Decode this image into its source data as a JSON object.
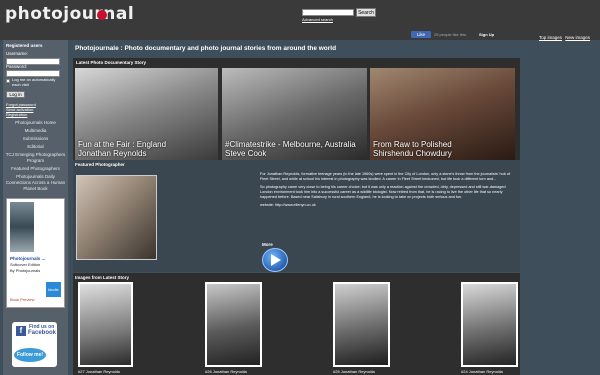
{
  "header": {
    "logo_text": "photojournal",
    "search_button": "Search",
    "advanced_search": "Advanced search"
  },
  "sidebar": {
    "title": "Registered users",
    "username_label": "Username:",
    "password_label": "Password:",
    "remember_label": "Log me on automatically each visit",
    "login_button": "Log in",
    "links": [
      "Forgot password",
      "Send activation",
      "Registration"
    ],
    "nav": [
      "Photojournals Home",
      "Multimedia",
      "Submissions",
      "Editorial",
      "TCJ Emerging Photographers Program",
      "Featured Photographers",
      "Photojournals Daily Connections Across a Human Planet Book"
    ]
  },
  "book": {
    "title": "Photojournals ...",
    "edition": "Softcover Edition",
    "author": "By Photojournals",
    "kindle": "kindle",
    "preview": "Book Preview"
  },
  "facebook": {
    "find_us": "Find us on",
    "name": "Facebook",
    "follow": "Follow me!",
    "like": "Like",
    "like_text": "25 people like this.",
    "signup": "Sign Up"
  },
  "toplinks": [
    "Top images",
    "New images"
  ],
  "page_title": "Photojournale : Photo documentary and photo journal stories from around the world",
  "latest_story": {
    "label": "Latest Photo Documentary Story",
    "items": [
      {
        "caption": "Fun at the Fair : England\nJonathan Reynolds"
      },
      {
        "caption": "#Climatestrike - Melbourne, Australia\nSteve Cook"
      },
      {
        "caption": "From Raw to Polished\nShirshendu Chowdury"
      }
    ]
  },
  "featured": {
    "label": "Featured Photographer",
    "bio": [
      "For Jonathan Reynolds, formative teenage years (in the late 1960s) were spent in the City of London, only a stone's throw from the journalists' hub of Fleet Street, and while at school his interest in photography was kindled. A career in Fleet Street beckoned, but life took a different turn and...",
      "So photography came very close to being his career choice; but it was only a reaction against the crowded, dirty, depressed and still war-damaged London environment took him into a successful career as a wildlife biologist. Now retired from that, he is racing to live the other life that so nearly happened before. Based near Salisbury in rural southern England, he is looking to take on projects both serious and fun.",
      "website: http://www.ellenyn.co.uk"
    ],
    "more": "More"
  },
  "images_story": {
    "label": "Images from Latest Story",
    "captions": [
      "#27 Jonathan Reynolds",
      "#26 Jonathan Reynolds",
      "#25 Jonathan Reynolds",
      "#24 Jonathan Reynolds"
    ]
  }
}
